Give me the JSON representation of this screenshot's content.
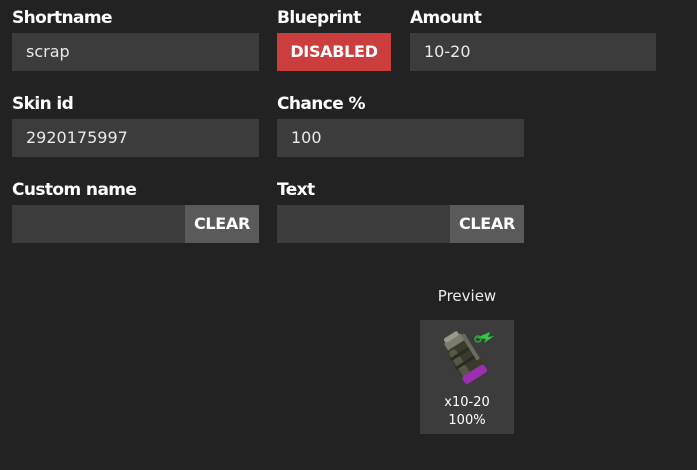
{
  "labels": {
    "shortname": "Shortname",
    "blueprint": "Blueprint",
    "amount": "Amount",
    "skin_id": "Skin id",
    "chance": "Chance %",
    "custom_name": "Custom name",
    "text": "Text"
  },
  "fields": {
    "shortname": "scrap",
    "amount": "10-20",
    "skin_id": "2920175997",
    "chance": "100",
    "custom_name": "",
    "text": ""
  },
  "buttons": {
    "blueprint": "DISABLED",
    "clear_custom_name": "CLEAR",
    "clear_text": "CLEAR"
  },
  "preview": {
    "title": "Preview",
    "icon": "smoke-grenade-icon",
    "amount": "x10-20",
    "chance": "100%"
  },
  "colors": {
    "background": "#222222",
    "field": "#3c3c3c",
    "disabled": "#cc3d3d",
    "clear": "#5a5a5a"
  }
}
